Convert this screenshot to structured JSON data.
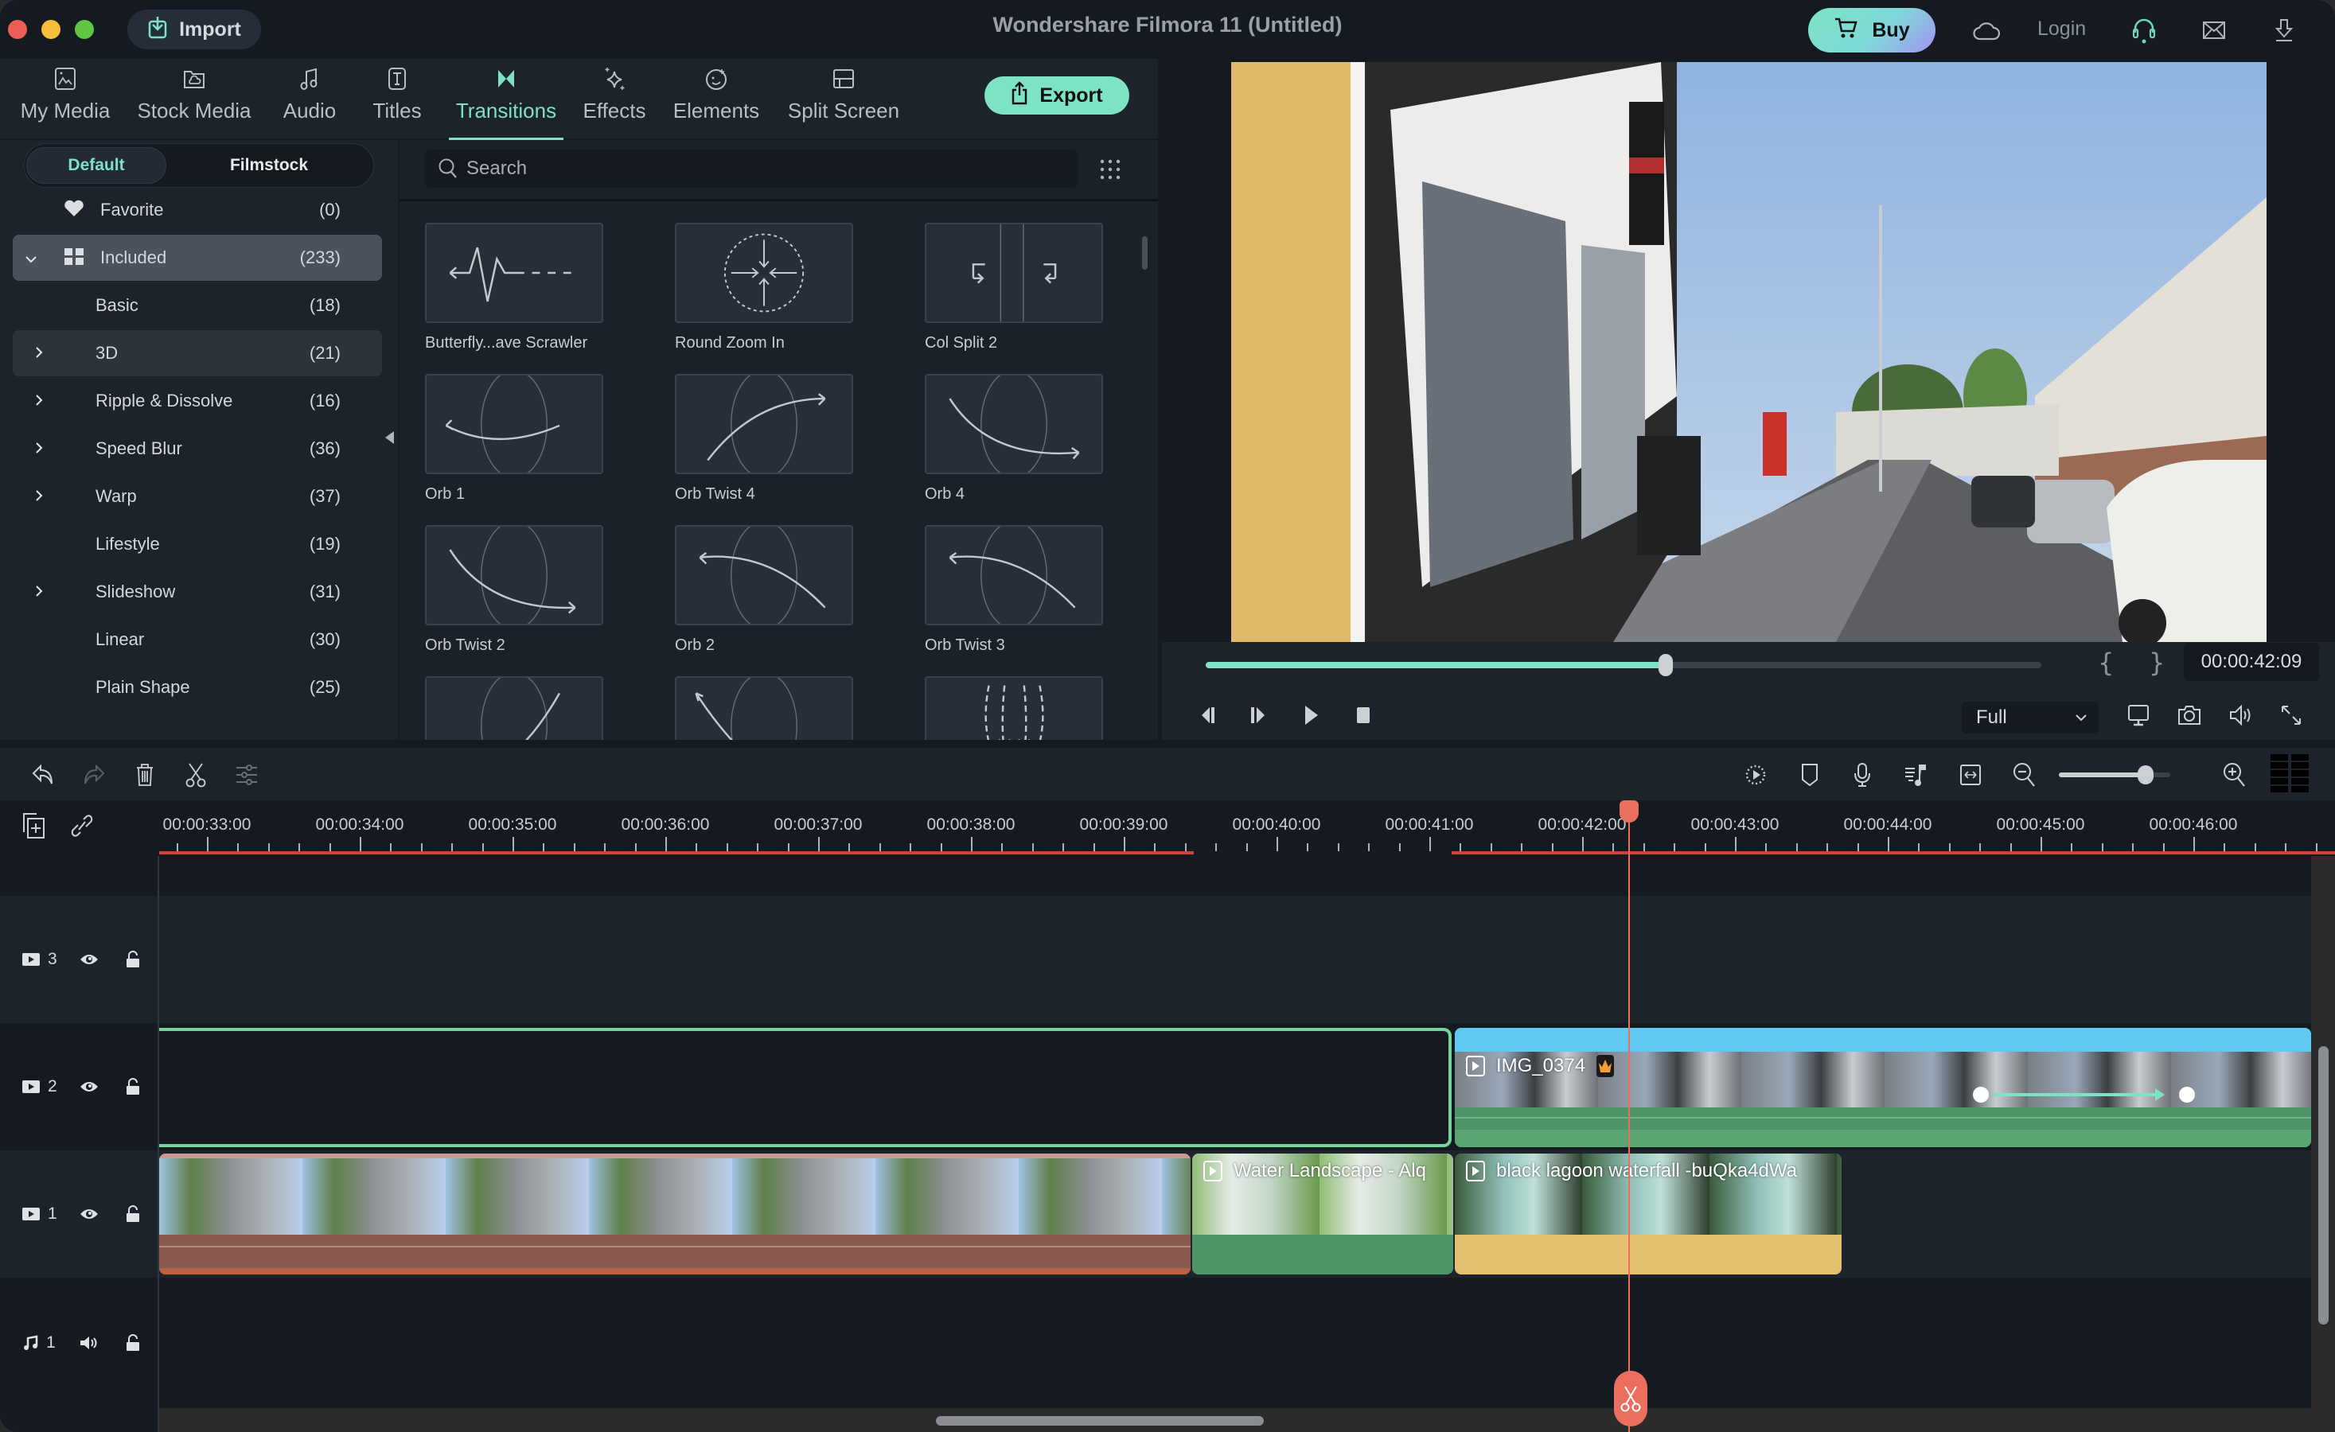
{
  "window": {
    "title": "Wondershare Filmora 11 (Untitled)",
    "import_label": "Import",
    "buy_label": "Buy",
    "login_label": "Login",
    "colors": {
      "accent": "#7de3c4",
      "playhead": "#ec6e5e",
      "bg": "#151a21",
      "panel": "#1d232b"
    }
  },
  "toptabs": {
    "items": [
      {
        "label": "My Media",
        "icon": "image-icon"
      },
      {
        "label": "Stock Media",
        "icon": "cloud-folder-icon"
      },
      {
        "label": "Audio",
        "icon": "music-note-icon"
      },
      {
        "label": "Titles",
        "icon": "text-t-icon"
      },
      {
        "label": "Transitions",
        "icon": "bowtie-icon",
        "active": true
      },
      {
        "label": "Effects",
        "icon": "sparkle-icon"
      },
      {
        "label": "Elements",
        "icon": "sticker-icon"
      },
      {
        "label": "Split Screen",
        "icon": "split-screen-icon"
      }
    ],
    "export_label": "Export"
  },
  "library": {
    "segments": [
      {
        "label": "Default",
        "active": true
      },
      {
        "label": "Filmstock",
        "active": false
      }
    ],
    "categories": [
      {
        "label": "Favorite",
        "count": "(0)",
        "icon": "heart-icon",
        "expander": ""
      },
      {
        "label": "Included",
        "count": "(233)",
        "icon": "grid-icon",
        "expander": "expanded",
        "selected": true
      },
      {
        "label": "Basic",
        "count": "(18)",
        "expander": ""
      },
      {
        "label": "3D",
        "count": "(21)",
        "expander": "collapsed",
        "hover": true
      },
      {
        "label": "Ripple & Dissolve",
        "count": "(16)",
        "expander": "collapsed"
      },
      {
        "label": "Speed Blur",
        "count": "(36)",
        "expander": "collapsed"
      },
      {
        "label": "Warp",
        "count": "(37)",
        "expander": "collapsed"
      },
      {
        "label": "Lifestyle",
        "count": "(19)",
        "expander": ""
      },
      {
        "label": "Slideshow",
        "count": "(31)",
        "expander": "collapsed"
      },
      {
        "label": "Linear",
        "count": "(30)",
        "expander": ""
      },
      {
        "label": "Plain Shape",
        "count": "(25)",
        "expander": ""
      }
    ]
  },
  "grid": {
    "search_placeholder": "Search",
    "items": [
      {
        "label": "Butterfly...ave Scrawler",
        "thumb": "wave"
      },
      {
        "label": "Round Zoom In",
        "thumb": "zoom"
      },
      {
        "label": "Col Split 2",
        "thumb": "colsplit"
      },
      {
        "label": "Orb 1",
        "thumb": "orb1"
      },
      {
        "label": "Orb Twist 4",
        "thumb": "orbtwist4"
      },
      {
        "label": "Orb 4",
        "thumb": "orb4"
      },
      {
        "label": "Orb Twist 2",
        "thumb": "orbtwist2"
      },
      {
        "label": "Orb 2",
        "thumb": "orb2"
      },
      {
        "label": "Orb Twist 3",
        "thumb": "orbtwist3"
      },
      {
        "label": "",
        "thumb": "orb5"
      },
      {
        "label": "",
        "thumb": "orb6"
      },
      {
        "label": "",
        "thumb": "arrows"
      }
    ]
  },
  "player": {
    "timecode": "00:00:42:09",
    "progress": 0.55,
    "mark_in": "{",
    "mark_out": "}",
    "quality": "Full"
  },
  "timeline": {
    "zoom_level": 0.78,
    "ruler_labels": [
      "00:00:33:00",
      "00:00:34:00",
      "00:00:35:00",
      "00:00:36:00",
      "00:00:37:00",
      "00:00:38:00",
      "00:00:39:00",
      "00:00:40:00",
      "00:00:41:00",
      "00:00:42:00",
      "00:00:43:00",
      "00:00:44:00",
      "00:00:45:00",
      "00:00:46:00"
    ],
    "tracks": [
      {
        "type": "video",
        "number": "3"
      },
      {
        "type": "video",
        "number": "2"
      },
      {
        "type": "video",
        "number": "1"
      },
      {
        "type": "audio",
        "number": "1"
      }
    ],
    "clips": [
      {
        "track": "2",
        "name": "IMG_0374",
        "kind": "video",
        "premium": true
      },
      {
        "track": "1",
        "name": "",
        "kind": "video"
      },
      {
        "track": "1",
        "name": "Water Landscape - Alq",
        "kind": "video"
      },
      {
        "track": "1",
        "name": "black lagoon waterfall -buQka4dWa",
        "kind": "video"
      }
    ]
  }
}
